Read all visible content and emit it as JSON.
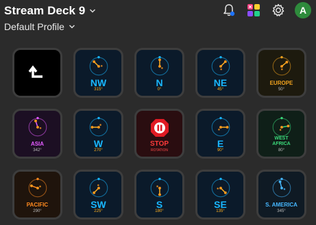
{
  "header": {
    "title": "Stream Deck 9",
    "profile": "Default Profile",
    "avatar_letter": "A",
    "icons": [
      "bell-icon",
      "plugins-icon",
      "gear-icon"
    ]
  },
  "colors": {
    "background": "#2b2b2b",
    "key_border": "#3d3d3d",
    "cyan": "#19b7ff",
    "avatar": "#2e8b3c"
  },
  "keys": [
    {
      "name": "back",
      "label": "",
      "sub": "",
      "icon": "back-arrow-icon"
    },
    {
      "name": "nw",
      "label": "NW",
      "sub": "315°",
      "icon": "compass-icon"
    },
    {
      "name": "n",
      "label": "N",
      "sub": "0°",
      "icon": "compass-icon"
    },
    {
      "name": "ne",
      "label": "NE",
      "sub": "45°",
      "icon": "compass-icon"
    },
    {
      "name": "europe",
      "label": "EUROPE",
      "sub": "50°",
      "icon": "compass-icon"
    },
    {
      "name": "asia",
      "label": "ASIA",
      "sub": "342°",
      "icon": "compass-icon"
    },
    {
      "name": "w",
      "label": "W",
      "sub": "270°",
      "icon": "compass-icon"
    },
    {
      "name": "stop",
      "label": "STOP",
      "sub": "ROTATION",
      "icon": "stop-icon"
    },
    {
      "name": "e",
      "label": "E",
      "sub": "90°",
      "icon": "compass-icon"
    },
    {
      "name": "west-africa",
      "label": "WEST",
      "label2": "AFRICA",
      "sub": "80°",
      "icon": "compass-icon"
    },
    {
      "name": "pacific",
      "label": "PACIFIC",
      "sub": "290°",
      "icon": "compass-icon"
    },
    {
      "name": "sw",
      "label": "SW",
      "sub": "225°",
      "icon": "compass-icon"
    },
    {
      "name": "s",
      "label": "S",
      "sub": "180°",
      "icon": "compass-icon"
    },
    {
      "name": "se",
      "label": "SE",
      "sub": "135°",
      "icon": "compass-icon"
    },
    {
      "name": "s-america",
      "label": "S. AMERICA",
      "sub": "345°",
      "icon": "compass-icon"
    }
  ]
}
